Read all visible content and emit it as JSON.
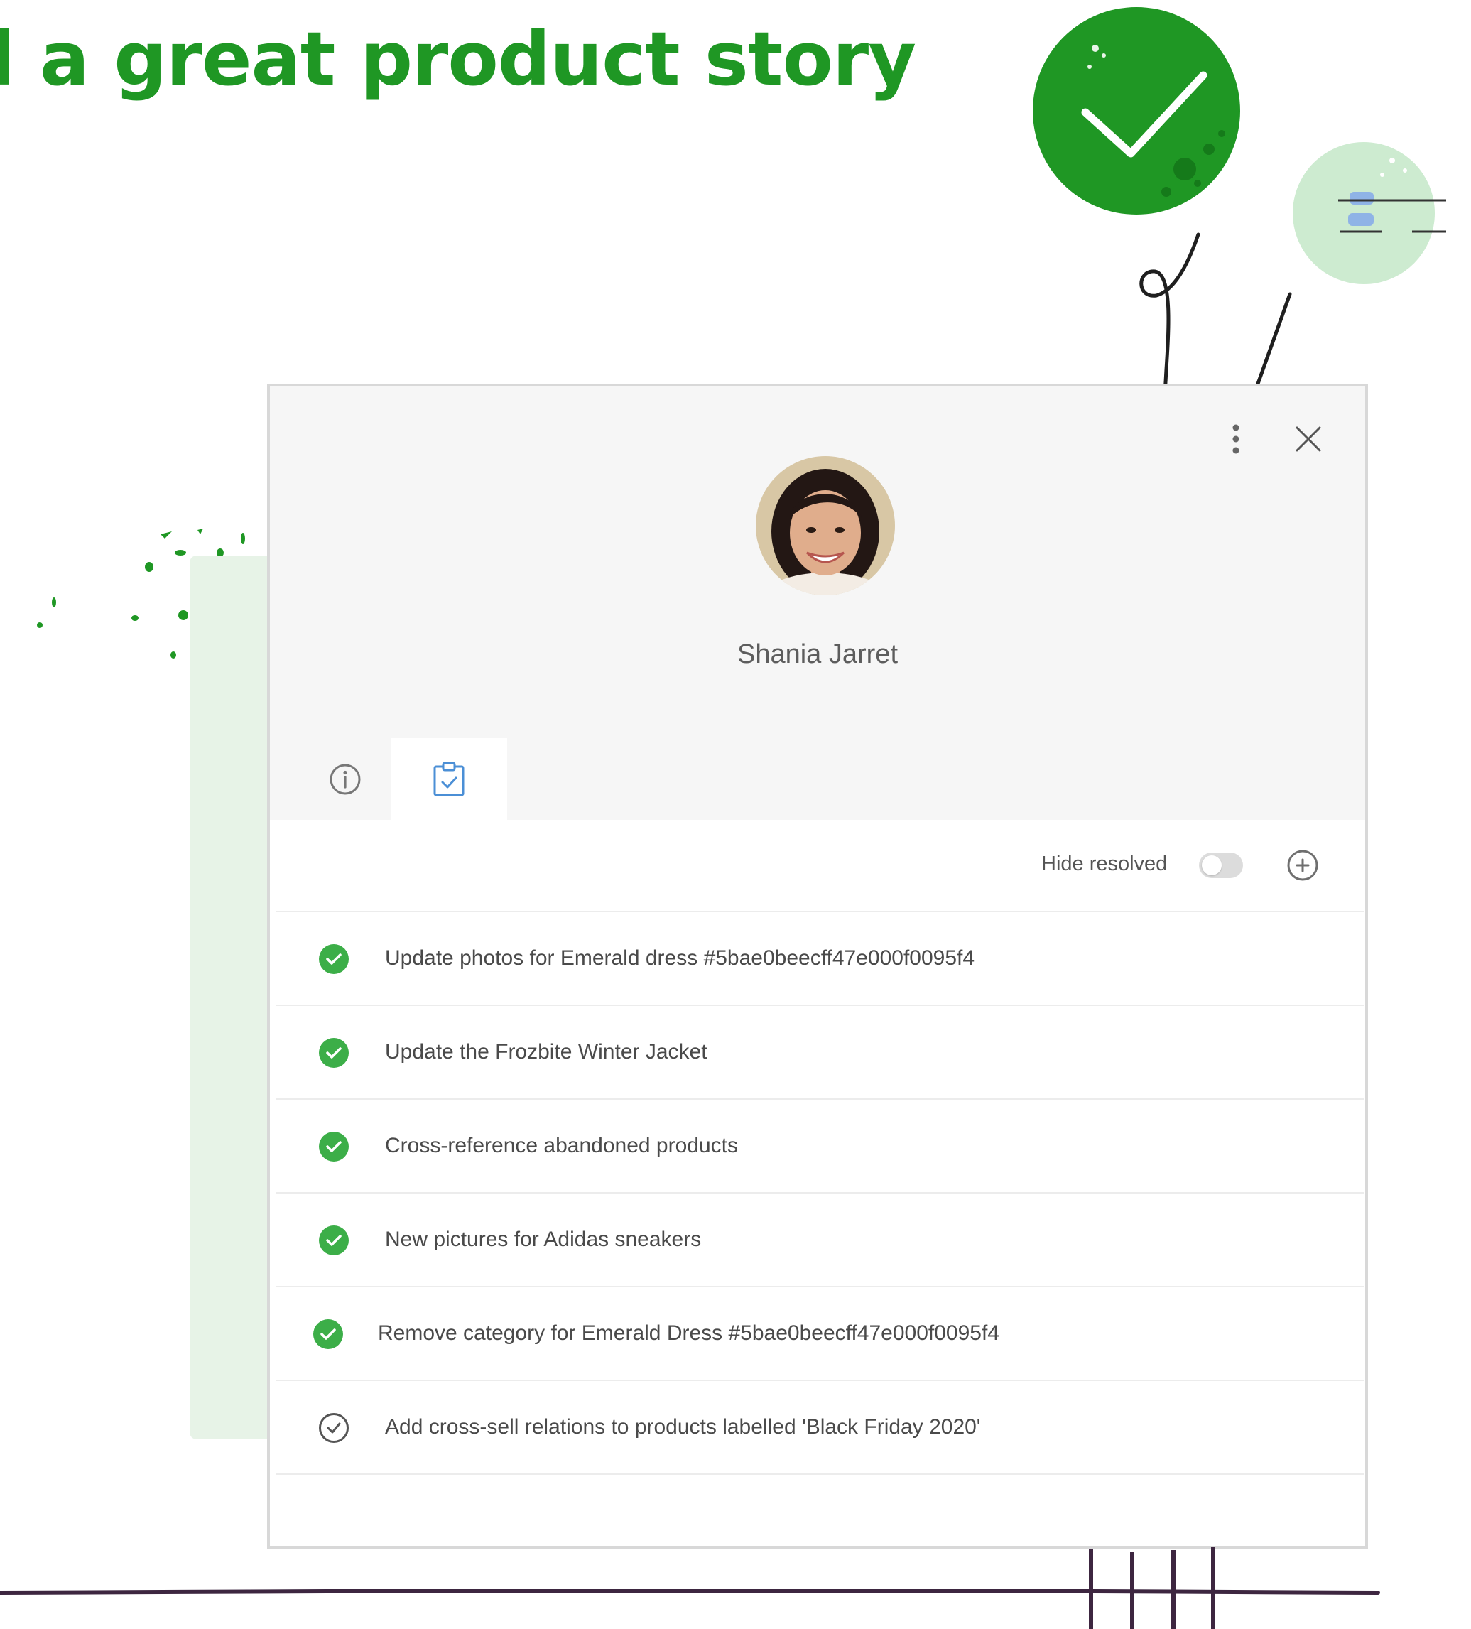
{
  "headline": "l a great product story",
  "user": {
    "name": "Shania Jarret"
  },
  "tabs": [
    {
      "icon": "info-icon",
      "active": false
    },
    {
      "icon": "clipboard-check-icon",
      "active": true
    }
  ],
  "toolbar": {
    "hide_resolved_label": "Hide resolved",
    "hide_resolved_on": false
  },
  "tasks": [
    {
      "text": "Update photos for Emerald dress #5bae0beecff47e000f0095f4",
      "resolved": true
    },
    {
      "text": "Update the Frozbite Winter Jacket",
      "resolved": true
    },
    {
      "text": "Cross-reference abandoned products",
      "resolved": true
    },
    {
      "text": "New pictures for Adidas sneakers",
      "resolved": true
    },
    {
      "text": "Remove category for Emerald Dress #5bae0beecff47e000f0095f4",
      "resolved": true
    },
    {
      "text": "Add cross-sell relations to products labelled 'Black Friday 2020'",
      "resolved": false
    }
  ],
  "colors": {
    "brand_green": "#1f9724",
    "resolved_green": "#3cae48",
    "light_green": "#cdebd0",
    "accent_blue": "#4b8fd6"
  }
}
